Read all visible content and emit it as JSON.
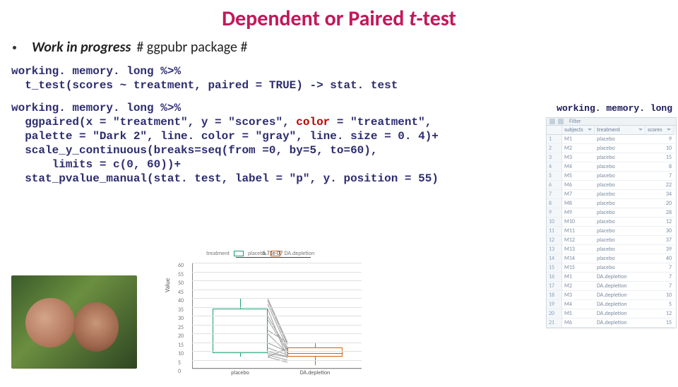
{
  "title": {
    "pre": "Dependent or Paired ",
    "ital": "t",
    "post": "-test"
  },
  "bullet": {
    "wip": "Work in progress",
    "rest": "# ggpubr package #"
  },
  "code1": "working. memory. long %>%\n  t_test(scores ~ treatment, paired = TRUE) -> stat. test",
  "code2": {
    "l1a": "working. memory. long %>%\n  ggpaired(x = \"treatment\", y = \"scores\", ",
    "l1arg": "color",
    "l1b": " = \"treatment\",\n  palette = \"Dark 2\", line. color = \"gray\", line. size = 0. 4)+\n  scale_y_continuous(breaks=seq(from =0, by=5, to=60),\n      limits = c(0, 60))+\n  stat_pvalue_manual(stat. test, label = \"p\", y. position = 55)"
  },
  "side_label": "working. memory. long",
  "table": {
    "headers": [
      "",
      "subjects",
      "treatment",
      "scores"
    ],
    "rows": [
      [
        "1",
        "M1",
        "placebo",
        "9"
      ],
      [
        "2",
        "M2",
        "placebo",
        "10"
      ],
      [
        "3",
        "M3",
        "placebo",
        "15"
      ],
      [
        "4",
        "M4",
        "placebo",
        "8"
      ],
      [
        "5",
        "M5",
        "placebo",
        "7"
      ],
      [
        "6",
        "M6",
        "placebo",
        "22"
      ],
      [
        "7",
        "M7",
        "placebo",
        "34"
      ],
      [
        "8",
        "M8",
        "placebo",
        "20"
      ],
      [
        "9",
        "M9",
        "placebo",
        "28"
      ],
      [
        "10",
        "M10",
        "placebo",
        "12"
      ],
      [
        "11",
        "M11",
        "placebo",
        "30"
      ],
      [
        "12",
        "M12",
        "placebo",
        "37"
      ],
      [
        "13",
        "M13",
        "placebo",
        "39"
      ],
      [
        "14",
        "M14",
        "placebo",
        "40"
      ],
      [
        "15",
        "M15",
        "placebo",
        "7"
      ],
      [
        "16",
        "M1",
        "DA.depletion",
        "7"
      ],
      [
        "17",
        "M2",
        "DA.depletion",
        "7"
      ],
      [
        "18",
        "M3",
        "DA.depletion",
        "10"
      ],
      [
        "19",
        "M4",
        "DA.depletion",
        "5"
      ],
      [
        "20",
        "M5",
        "DA.depletion",
        "12"
      ],
      [
        "21",
        "M6",
        "DA.depletion",
        "15"
      ]
    ],
    "filter": "Filter"
  },
  "chart_data": {
    "type": "paired-box",
    "title": "",
    "ylabel": "Value",
    "ylim": [
      0,
      60
    ],
    "yticks": [
      0,
      5,
      10,
      15,
      20,
      25,
      30,
      35,
      40,
      45,
      50,
      55,
      60
    ],
    "categories": [
      "placebo",
      "DA.depletion"
    ],
    "legend": {
      "label": "treatment",
      "items": [
        "placebo",
        "DA.depletion"
      ],
      "colors": [
        "#1b9e77",
        "#d95f02"
      ]
    },
    "boxes": [
      {
        "name": "placebo",
        "min": 7,
        "q1": 9,
        "median": 20,
        "q3": 34,
        "max": 40,
        "color": "#1b9e77"
      },
      {
        "name": "DA.depletion",
        "min": 2,
        "q1": 7,
        "median": 9,
        "q3": 12,
        "max": 15,
        "color": "#d95f02"
      }
    ],
    "pvalue": "5.71e-07",
    "pvalue_y": 55,
    "paired_lines": [
      [
        9,
        7
      ],
      [
        10,
        7
      ],
      [
        15,
        10
      ],
      [
        8,
        5
      ],
      [
        7,
        12
      ],
      [
        22,
        15
      ],
      [
        34,
        6
      ],
      [
        20,
        9
      ],
      [
        28,
        10
      ],
      [
        12,
        8
      ],
      [
        30,
        11
      ],
      [
        37,
        12
      ],
      [
        39,
        14
      ],
      [
        40,
        15
      ],
      [
        7,
        4
      ]
    ]
  }
}
